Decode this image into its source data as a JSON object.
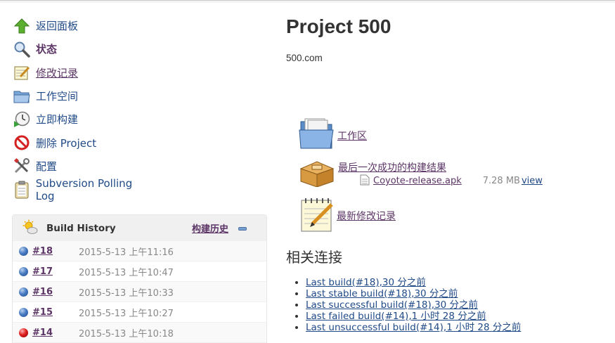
{
  "sidebar": {
    "items": [
      {
        "label": "返回面板",
        "icon": "up-arrow-icon"
      },
      {
        "label": "状态",
        "icon": "magnifier-icon"
      },
      {
        "label": "修改记录",
        "icon": "notepad-icon"
      },
      {
        "label": "工作空间",
        "icon": "folder-icon"
      },
      {
        "label": "立即构建",
        "icon": "clock-build-icon"
      },
      {
        "label": "删除 Project",
        "icon": "no-entry-icon"
      },
      {
        "label": "配置",
        "icon": "tools-icon"
      },
      {
        "label": "Subversion Polling Log",
        "icon": "clipboard-icon"
      }
    ]
  },
  "build_history": {
    "title": "Build History",
    "trend_label": "构建历史",
    "builds": [
      {
        "number": "#18",
        "date": "2015-5-13 上午11:16",
        "status": "blue"
      },
      {
        "number": "#17",
        "date": "2015-5-13 上午10:47",
        "status": "blue"
      },
      {
        "number": "#16",
        "date": "2015-5-13 上午10:33",
        "status": "blue"
      },
      {
        "number": "#15",
        "date": "2015-5-13 上午10:27",
        "status": "blue"
      },
      {
        "number": "#14",
        "date": "2015-5-13 上午10:18",
        "status": "red"
      }
    ]
  },
  "main": {
    "title": "Project 500",
    "description": "500.com",
    "workspace_label": "工作区",
    "last_success_label": "最后一次成功的构建结果",
    "artifact": {
      "name": "Coyote-release.apk",
      "size": "7.28 MB",
      "view": "view"
    },
    "changes_label": "最新修改记录",
    "related_title": "相关连接",
    "related_links": [
      "Last build(#18),30 分之前",
      "Last stable build(#18),30 分之前",
      "Last successful build(#18),30 分之前",
      "Last failed build(#14),1 小时 28 分之前",
      "Last unsuccessful build(#14),1 小时 28 分之前"
    ]
  },
  "colors": {
    "link": "#204a87",
    "visited": "#5c3566",
    "success_ball": "#4a7cc2",
    "failed_ball": "#e02020"
  }
}
